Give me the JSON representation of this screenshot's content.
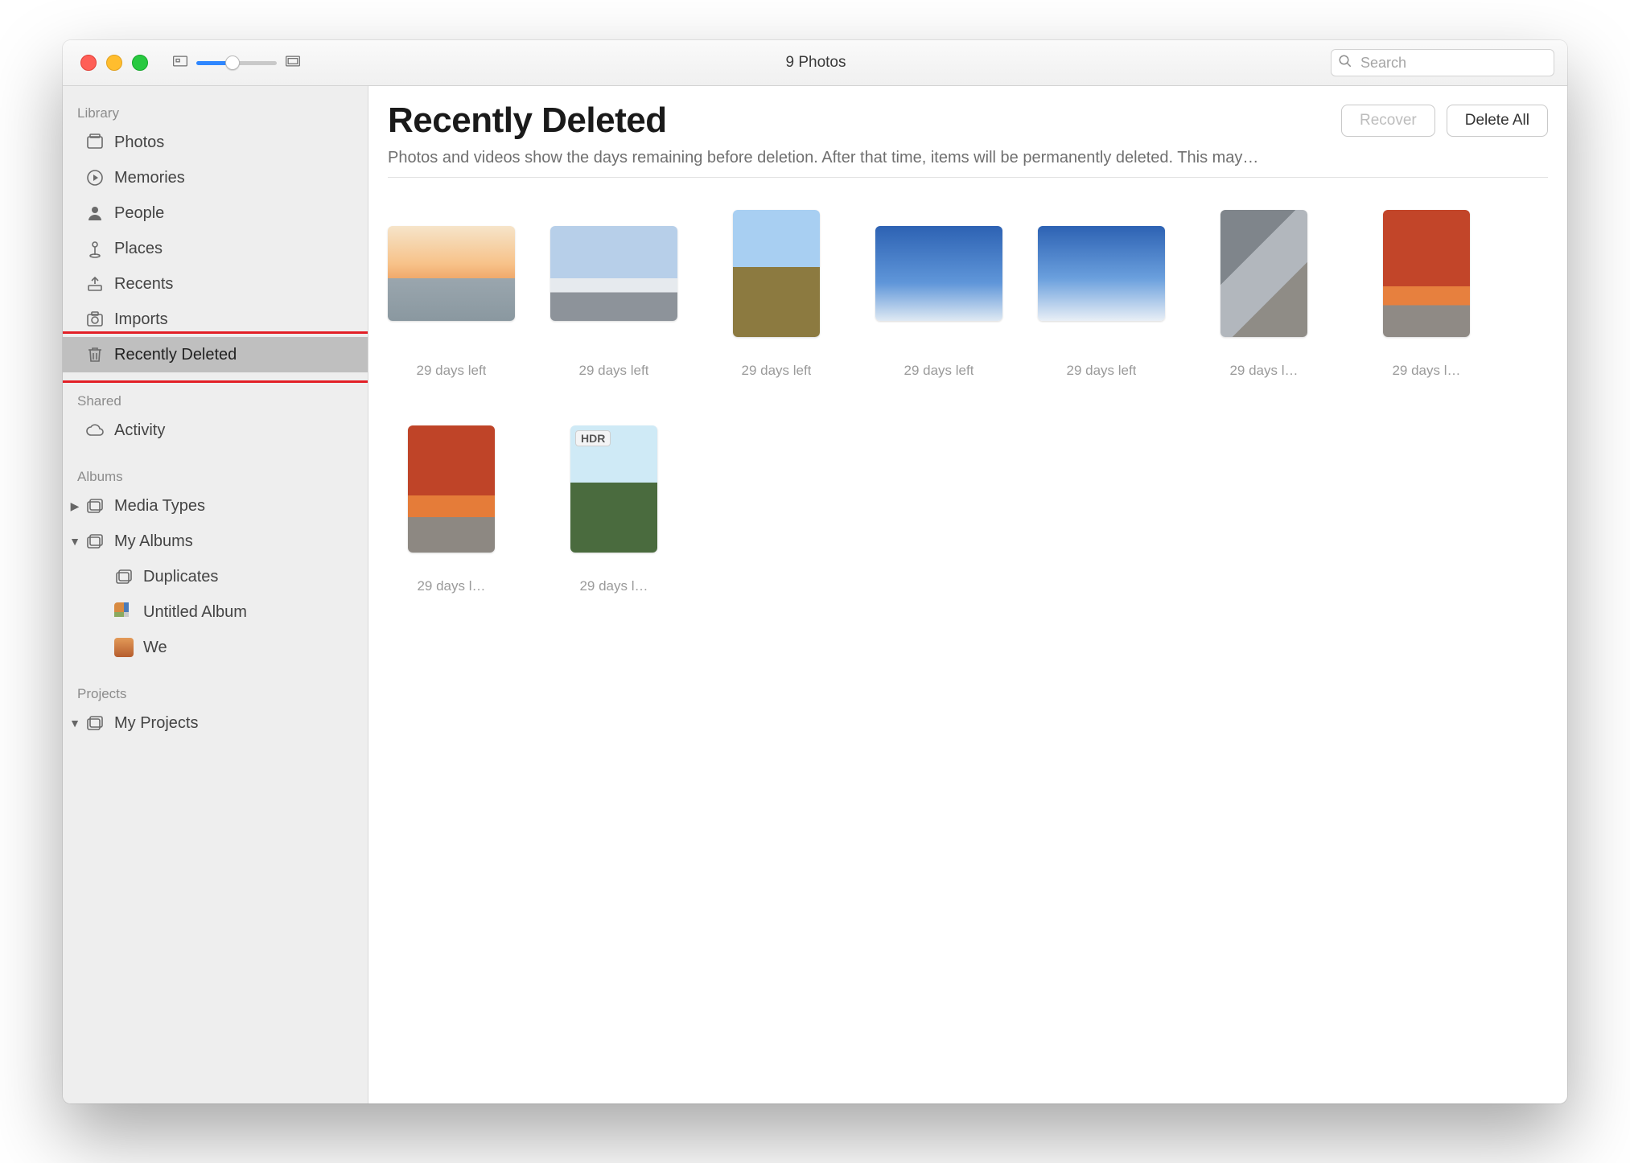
{
  "window": {
    "title": "9 Photos"
  },
  "search": {
    "placeholder": "Search"
  },
  "sidebar": {
    "sections": {
      "library": {
        "header": "Library",
        "items": [
          {
            "label": "Photos",
            "icon": "photos"
          },
          {
            "label": "Memories",
            "icon": "memories"
          },
          {
            "label": "People",
            "icon": "people"
          },
          {
            "label": "Places",
            "icon": "places"
          },
          {
            "label": "Recents",
            "icon": "recents"
          },
          {
            "label": "Imports",
            "icon": "imports"
          },
          {
            "label": "Recently Deleted",
            "icon": "trash",
            "selected": true
          }
        ]
      },
      "shared": {
        "header": "Shared",
        "items": [
          {
            "label": "Activity",
            "icon": "cloud"
          }
        ]
      },
      "albums": {
        "header": "Albums",
        "items": [
          {
            "label": "Media Types",
            "icon": "stack",
            "disclosure": "right"
          },
          {
            "label": "My Albums",
            "icon": "stack",
            "disclosure": "down",
            "children": [
              {
                "label": "Duplicates",
                "icon": "stack"
              },
              {
                "label": "Untitled Album",
                "icon": "thumb-mosaic"
              },
              {
                "label": "We",
                "icon": "thumb-we"
              }
            ]
          }
        ]
      },
      "projects": {
        "header": "Projects",
        "items": [
          {
            "label": "My Projects",
            "icon": "stack",
            "disclosure": "down"
          }
        ]
      }
    }
  },
  "main": {
    "title": "Recently Deleted",
    "subtitle": "Photos and videos show the days remaining before deletion. After that time, items will be permanently deleted. This may…",
    "recover_label": "Recover",
    "delete_all_label": "Delete All",
    "items": [
      {
        "caption": "29 days left",
        "shape": "landscape",
        "style": "t-sunset"
      },
      {
        "caption": "29 days left",
        "shape": "landscape",
        "style": "t-mtn"
      },
      {
        "caption": "29 days left",
        "shape": "portrait",
        "style": "t-vines"
      },
      {
        "caption": "29 days left",
        "shape": "landscape",
        "style": "t-sky1"
      },
      {
        "caption": "29 days left",
        "shape": "landscape",
        "style": "t-sky2"
      },
      {
        "caption": "29 days l…",
        "shape": "portrait",
        "style": "t-mural"
      },
      {
        "caption": "29 days l…",
        "shape": "portrait",
        "style": "t-orange"
      },
      {
        "caption": "29 days l…",
        "shape": "portrait",
        "style": "t-orange2"
      },
      {
        "caption": "29 days l…",
        "shape": "portrait",
        "style": "t-palm",
        "badge": "HDR"
      }
    ]
  }
}
